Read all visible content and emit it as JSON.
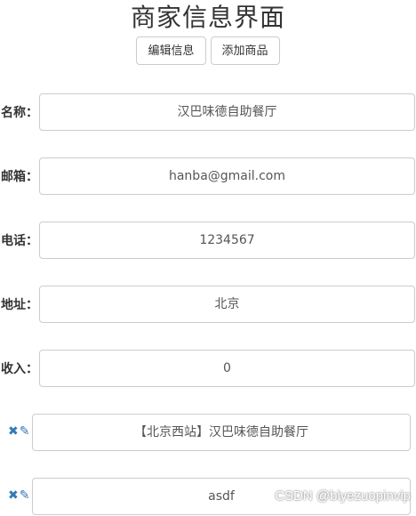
{
  "page": {
    "title": "商家信息界面"
  },
  "toolbar": {
    "edit_label": "编辑信息",
    "add_label": "添加商品"
  },
  "fields": {
    "name": {
      "label": "名称：",
      "value": "汉巴味德自助餐厅"
    },
    "email": {
      "label": "邮箱：",
      "value": "hanba@gmail.com"
    },
    "phone": {
      "label": "电话：",
      "value": "1234567"
    },
    "address": {
      "label": "地址：",
      "value": "北京"
    },
    "income": {
      "label": "收入：",
      "value": "0"
    }
  },
  "products": [
    {
      "name": "【北京西站】汉巴味德自助餐厅"
    },
    {
      "name": "asdf"
    }
  ],
  "icons": {
    "delete": "close-icon",
    "edit": "pencil-icon"
  },
  "colors": {
    "icon": "#337ab7"
  },
  "watermark": "CSDN @biyezuopinvip"
}
